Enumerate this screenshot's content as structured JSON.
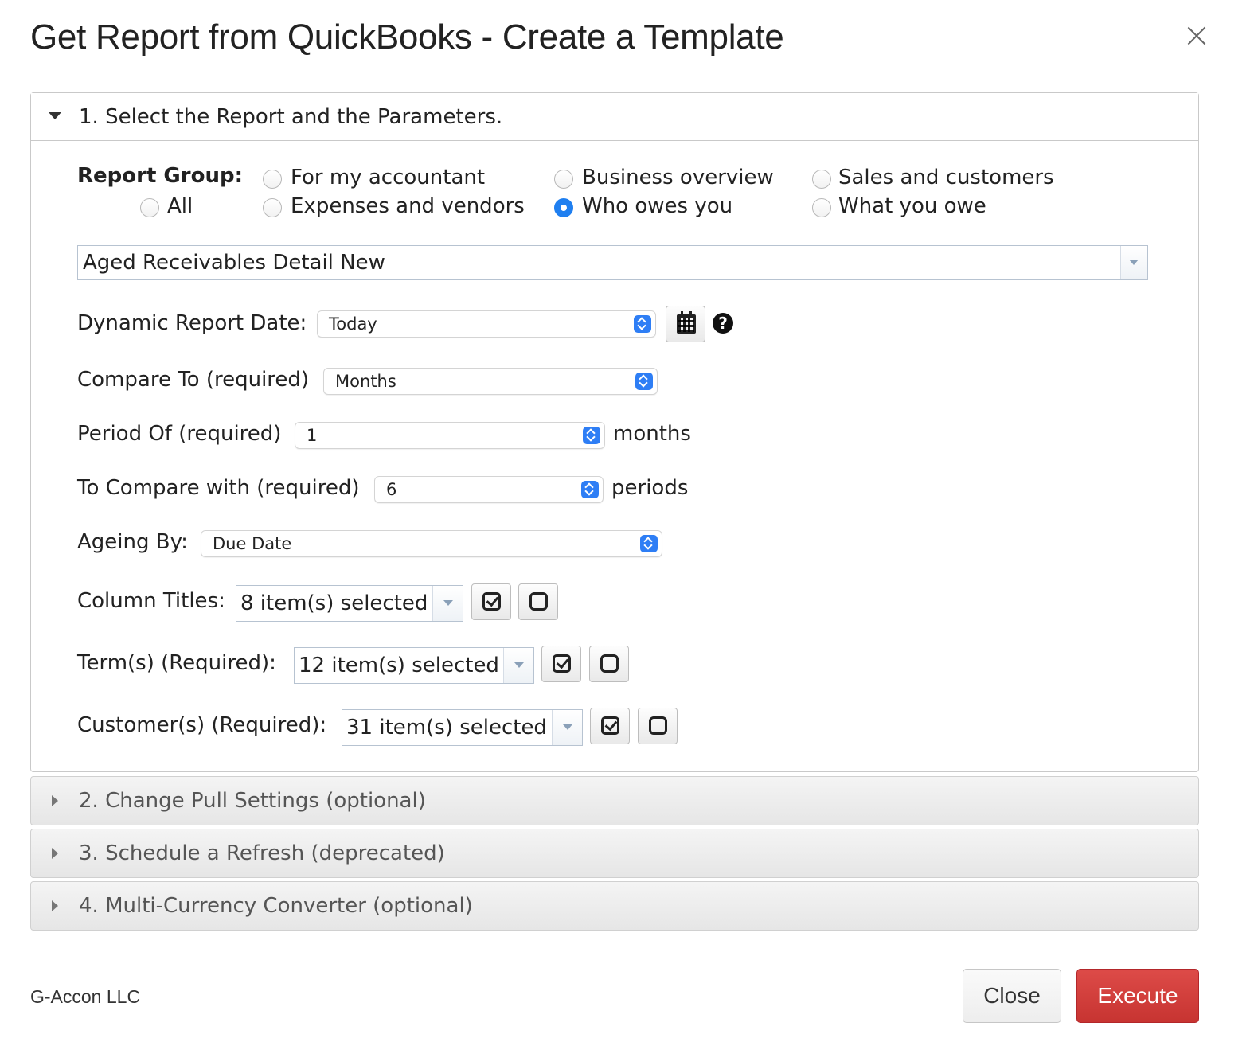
{
  "dialog": {
    "title": "Get Report from QuickBooks - Create a Template"
  },
  "sections": [
    {
      "label": "1. Select the Report and the Parameters.",
      "expanded": true
    },
    {
      "label": "2. Change Pull Settings (optional)",
      "expanded": false
    },
    {
      "label": "3. Schedule a Refresh (deprecated)",
      "expanded": false
    },
    {
      "label": "4. Multi-Currency Converter (optional)",
      "expanded": false
    }
  ],
  "report_group": {
    "label": "Report Group:",
    "options": [
      {
        "label": "All",
        "selected": false
      },
      {
        "label": "For my accountant",
        "selected": false
      },
      {
        "label": "Expenses and vendors",
        "selected": false
      },
      {
        "label": "Business overview",
        "selected": false
      },
      {
        "label": "Who owes you",
        "selected": true
      },
      {
        "label": "Sales and customers",
        "selected": false
      },
      {
        "label": "What you owe",
        "selected": false
      }
    ]
  },
  "report_select": {
    "value": "Aged Receivables Detail New"
  },
  "params": {
    "dynamic_date": {
      "label": "Dynamic Report Date:",
      "value": "Today"
    },
    "compare_to": {
      "label": "Compare To (required)",
      "value": "Months"
    },
    "period_of": {
      "label": "Period Of (required)",
      "value": "1",
      "suffix": "months"
    },
    "compare_with": {
      "label": "To Compare with (required)",
      "value": "6",
      "suffix": "periods"
    },
    "ageing_by": {
      "label": "Ageing By:",
      "value": "Due Date"
    },
    "column_titles": {
      "label": "Column Titles:",
      "value": "8 item(s) selected"
    },
    "terms": {
      "label": "Term(s) (Required):",
      "value": "12 item(s) selected"
    },
    "customers": {
      "label": "Customer(s) (Required):",
      "value": "31 item(s) selected"
    }
  },
  "help_glyph": "?",
  "footer": {
    "brand": "G-Accon LLC",
    "close_label": "Close",
    "execute_label": "Execute"
  },
  "colors": {
    "accent": "#1f7ff0",
    "execute": "#d13c39"
  }
}
